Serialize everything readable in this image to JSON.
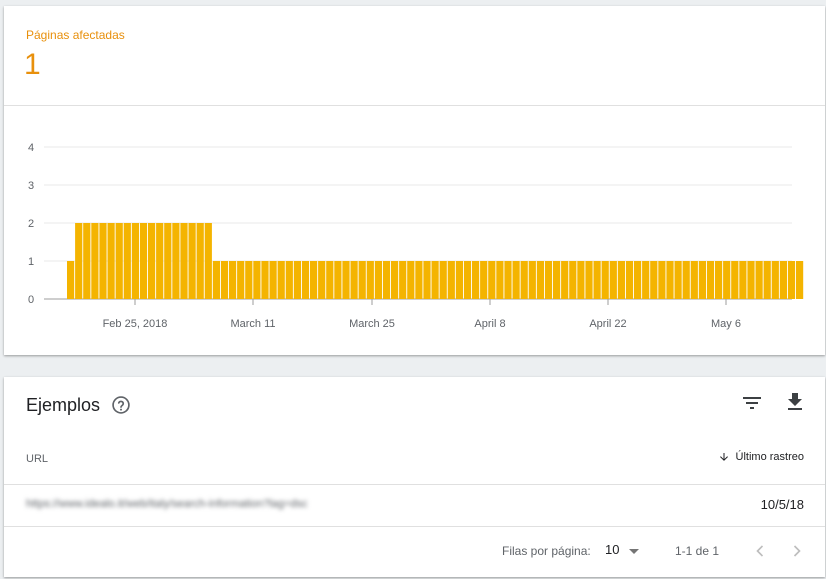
{
  "summary": {
    "metric_label": "Páginas afectadas",
    "metric_value": "1"
  },
  "colors": {
    "accent": "#e8900c",
    "bar": "#f4b400"
  },
  "chart_data": {
    "type": "bar",
    "y_ticks": [
      0,
      1,
      2,
      3,
      4
    ],
    "ylim": [
      0,
      4
    ],
    "x_tick_labels": [
      "Feb 25, 2018",
      "March 11",
      "March 25",
      "April 8",
      "April 22",
      "May 6"
    ],
    "grid": true,
    "values": [
      1,
      2,
      2,
      2,
      2,
      2,
      2,
      2,
      2,
      2,
      2,
      2,
      2,
      2,
      2,
      2,
      2,
      2,
      1,
      1,
      1,
      1,
      1,
      1,
      1,
      1,
      1,
      1,
      1,
      1,
      1,
      1,
      1,
      1,
      1,
      1,
      1,
      1,
      1,
      1,
      1,
      1,
      1,
      1,
      1,
      1,
      1,
      1,
      1,
      1,
      1,
      1,
      1,
      1,
      1,
      1,
      1,
      1,
      1,
      1,
      1,
      1,
      1,
      1,
      1,
      1,
      1,
      1,
      1,
      1,
      1,
      1,
      1,
      1,
      1,
      1,
      1,
      1,
      1,
      1,
      1,
      1,
      1,
      1,
      1,
      1,
      1,
      1,
      1,
      1,
      1
    ]
  },
  "examples": {
    "title": "Ejemplos",
    "help_icon": "help-circle-icon",
    "filter_icon": "filter-icon",
    "download_icon": "download-icon",
    "columns": {
      "url": "URL",
      "last_crawl": "Último rastreo"
    },
    "rows": [
      {
        "url": "https://www.idealo.it/web/italy/search-information?lag=dsc",
        "date": "10/5/18"
      }
    ],
    "pagination": {
      "rows_per_page_label": "Filas por página:",
      "rows_per_page_value": "10",
      "range": "1-1 de 1"
    }
  }
}
